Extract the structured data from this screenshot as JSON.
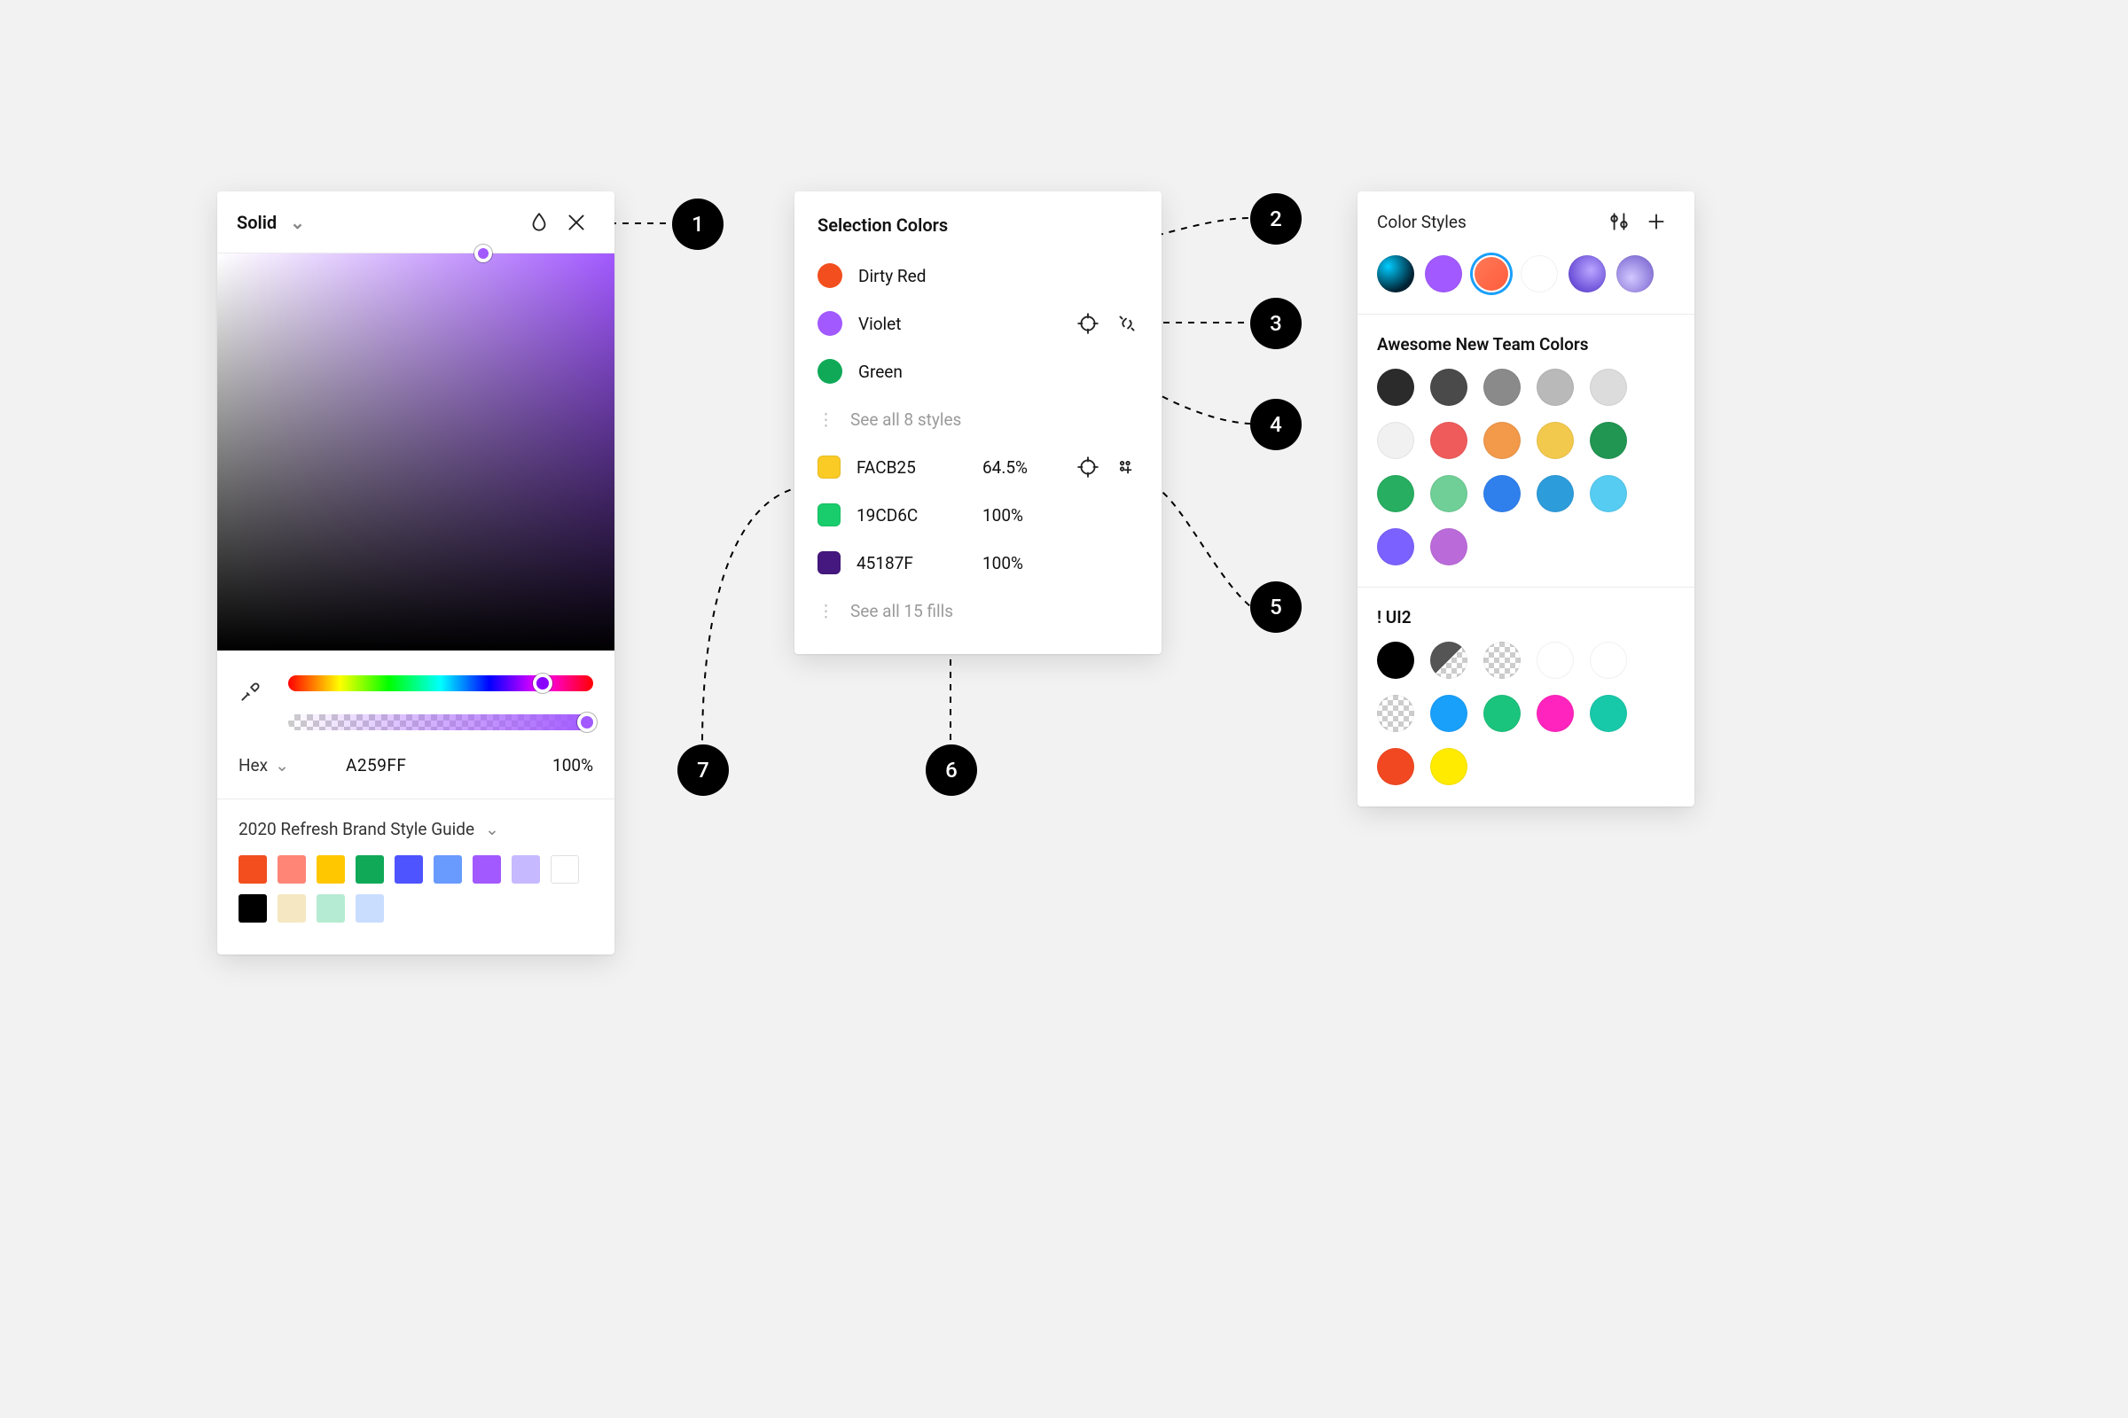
{
  "picker": {
    "mode_label": "Solid",
    "hex_label": "Hex",
    "hex_value": "A259FF",
    "opacity": "100%",
    "library_title": "2020 Refresh Brand Style Guide",
    "swatches": [
      "#F24E1E",
      "#FF8577",
      "#FFC700",
      "#0FA958",
      "#4E54FF",
      "#699BFF",
      "#A259FF",
      "#C7B9FF",
      "#FFFFFF",
      "#000000",
      "#F5E7C1",
      "#B6EBD3",
      "#C9DDFF"
    ]
  },
  "selection": {
    "title": "Selection Colors",
    "styles": [
      {
        "name": "Dirty Red",
        "color": "#F24E1E"
      },
      {
        "name": "Violet",
        "color": "#A259FF"
      },
      {
        "name": "Green",
        "color": "#0FA958"
      }
    ],
    "see_styles": "See all 8 styles",
    "fills": [
      {
        "hex": "FACB25",
        "opacity": "64.5%",
        "color": "#FACB25"
      },
      {
        "hex": "19CD6C",
        "opacity": "100%",
        "color": "#19CD6C"
      },
      {
        "hex": "45187F",
        "opacity": "100%",
        "color": "#45187F"
      }
    ],
    "see_fills": "See all 15 fills"
  },
  "styles": {
    "title": "Color Styles",
    "favorites": [
      {
        "kind": "image",
        "bg": "radial-gradient(circle at 30% 30%, #0cf, #023 70%)"
      },
      {
        "kind": "solid",
        "bg": "#A259FF"
      },
      {
        "kind": "solid",
        "bg": "linear-gradient(135deg,#ff7a59,#ff5b3a)",
        "selected": true
      },
      {
        "kind": "solid",
        "bg": "#ffffff"
      },
      {
        "kind": "image",
        "bg": "radial-gradient(circle at 60% 40%, #b9a6ff, #6b4fd8 70%)"
      },
      {
        "kind": "image",
        "bg": "radial-gradient(circle at 40% 60%, #d3c7ff, #8a77d9 70%)"
      }
    ],
    "groups": [
      {
        "title": "Awesome New Team Colors",
        "colors": [
          "#2b2b2b",
          "#4a4a4a",
          "#8a8a8a",
          "#b9b9b9",
          "#dcdcdc",
          "#f1f1f1",
          "#ef5b5b",
          "#f2994a",
          "#f2c94c",
          "#219653",
          "#27ae60",
          "#6fcf97",
          "#2f80ed",
          "#2d9cdb",
          "#56ccf2",
          "#7b61ff",
          "#bb6bd9"
        ]
      },
      {
        "title": "! UI2",
        "colors_special": [
          {
            "bg": "#000000"
          },
          {
            "class": "half-checker"
          },
          {
            "class": "checker"
          },
          {
            "bg": "#ffffff"
          },
          {
            "bg": "#ffffff"
          },
          {
            "class": "checker"
          },
          {
            "bg": "#18A0FB"
          },
          {
            "bg": "#1BC47D"
          },
          {
            "bg": "#FF24BD"
          },
          {
            "bg": "#18C9A9"
          },
          {
            "bg": "#F24822"
          },
          {
            "bg": "#FFEB00"
          }
        ]
      }
    ]
  },
  "annotations": {
    "b1": "1",
    "b2": "2",
    "b3": "3",
    "b4": "4",
    "b5": "5",
    "b6": "6",
    "b7": "7"
  }
}
